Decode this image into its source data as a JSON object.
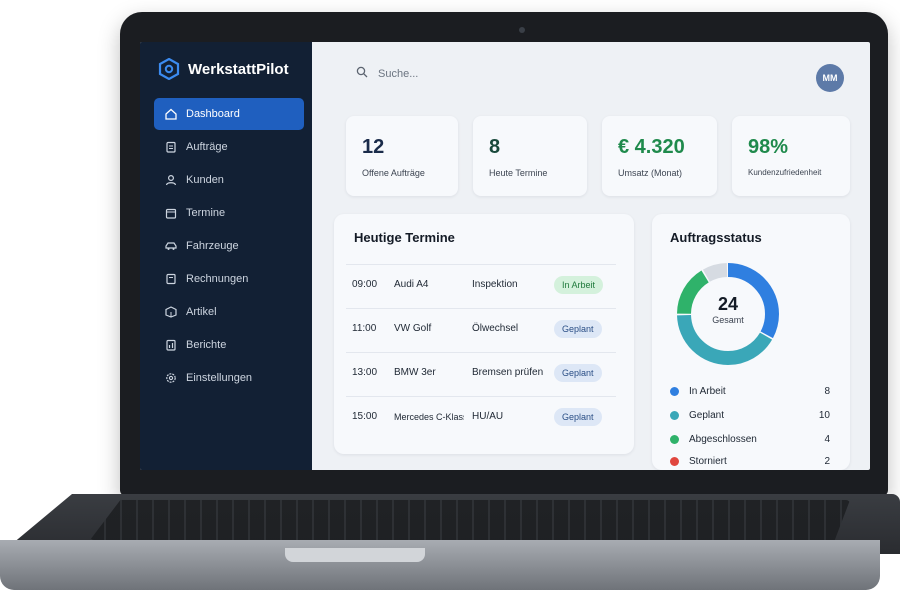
{
  "app": {
    "name": "WerkstattPilot"
  },
  "sidebar": {
    "items": [
      {
        "label": "Dashboard",
        "icon": "home-icon",
        "active": true
      },
      {
        "label": "Aufträge",
        "icon": "clipboard-icon"
      },
      {
        "label": "Kunden",
        "icon": "user-icon"
      },
      {
        "label": "Termine",
        "icon": "calendar-icon"
      },
      {
        "label": "Fahrzeuge",
        "icon": "car-icon"
      },
      {
        "label": "Rechnungen",
        "icon": "invoice-icon"
      },
      {
        "label": "Artikel",
        "icon": "box-icon"
      },
      {
        "label": "Berichte",
        "icon": "report-icon"
      },
      {
        "label": "Einstellungen",
        "icon": "gear-icon"
      }
    ]
  },
  "search": {
    "placeholder": "Suche..."
  },
  "user": {
    "initials": "MM"
  },
  "stats": [
    {
      "value": "12",
      "label": "Offene Aufträge",
      "color": "#1a2b4a"
    },
    {
      "value": "8",
      "label": "Heute Termine",
      "color": "#1a4a3c"
    },
    {
      "value": "€ 4.320",
      "label": "Umsatz (Monat)",
      "color": "#1f8a4c"
    },
    {
      "value": "98%",
      "label": "Kundenzufriedenheit",
      "color": "#1f8a4c"
    }
  ],
  "appointments": {
    "title": "Heutige Termine",
    "rows": [
      {
        "time": "09:00",
        "vehicle": "Audi A4",
        "service": "Inspektion",
        "status": "In Arbeit",
        "status_type": "arbeit"
      },
      {
        "time": "11:00",
        "vehicle": "VW Golf",
        "service": "Ölwechsel",
        "status": "Geplant",
        "status_type": "geplant"
      },
      {
        "time": "13:00",
        "vehicle": "BMW 3er",
        "service": "Bremsen prüfen",
        "status": "Geplant",
        "status_type": "geplant"
      },
      {
        "time": "15:00",
        "vehicle": "Mercedes C-Klasse",
        "service": "HU/AU",
        "status": "Geplant",
        "status_type": "geplant"
      }
    ]
  },
  "order_status": {
    "title": "Auftragsstatus",
    "total": "24",
    "total_label": "Gesamt",
    "segments": [
      {
        "label": "In Arbeit",
        "count": 8,
        "color": "#2f7fe0"
      },
      {
        "label": "Geplant",
        "count": 10,
        "color": "#3aa7b8"
      },
      {
        "label": "Abgeschlossen",
        "count": 4,
        "color": "#2fb26a"
      },
      {
        "label": "Storniert",
        "count": 2,
        "color": "#e0463f"
      }
    ]
  }
}
